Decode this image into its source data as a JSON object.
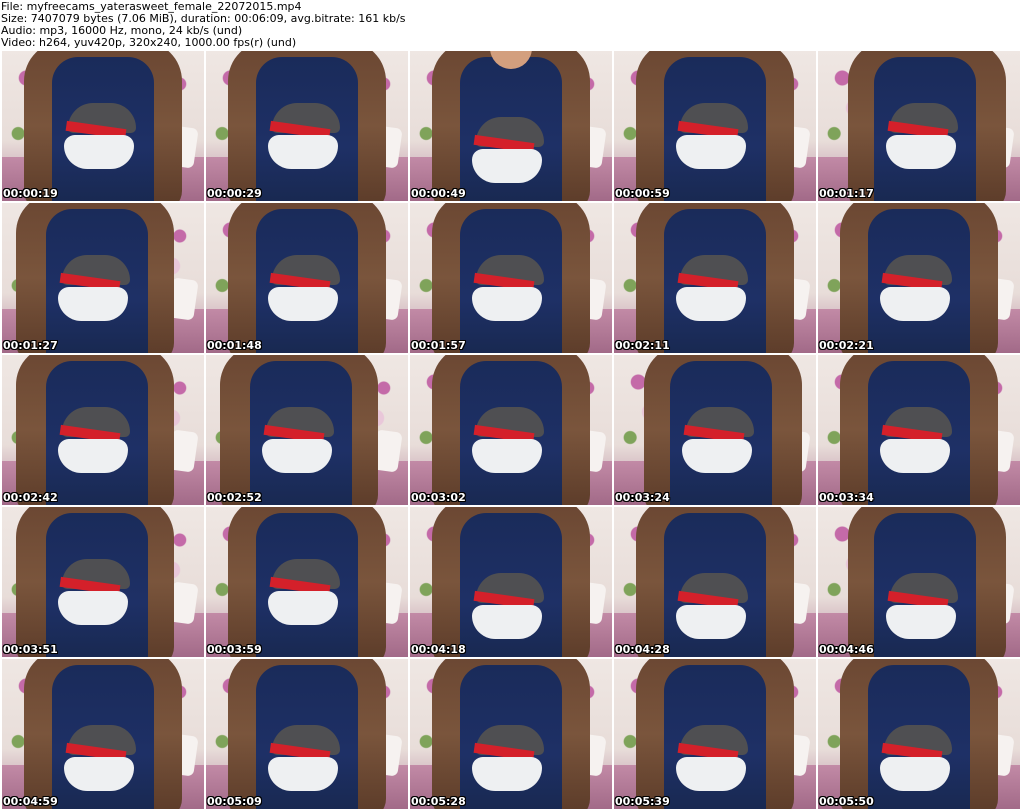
{
  "header": {
    "file_line": "File: myfreecams_yaterasweet_female_22072015.mp4",
    "size_line": "Size: 7407079 bytes (7.06 MiB), duration: 00:06:09, avg.bitrate: 161 kb/s",
    "audio_line": "Audio: mp3, 16000 Hz, mono, 24 kb/s (und)",
    "video_line": "Video: h264, yuv420p, 320x240, 1000.00 fps(r) (und)"
  },
  "thumbnails": [
    {
      "timestamp": "00:00:19"
    },
    {
      "timestamp": "00:00:29"
    },
    {
      "timestamp": "00:00:49"
    },
    {
      "timestamp": "00:00:59"
    },
    {
      "timestamp": "00:01:17"
    },
    {
      "timestamp": "00:01:27"
    },
    {
      "timestamp": "00:01:48"
    },
    {
      "timestamp": "00:01:57"
    },
    {
      "timestamp": "00:02:11"
    },
    {
      "timestamp": "00:02:21"
    },
    {
      "timestamp": "00:02:42"
    },
    {
      "timestamp": "00:02:52"
    },
    {
      "timestamp": "00:03:02"
    },
    {
      "timestamp": "00:03:24"
    },
    {
      "timestamp": "00:03:34"
    },
    {
      "timestamp": "00:03:51"
    },
    {
      "timestamp": "00:03:59"
    },
    {
      "timestamp": "00:04:18"
    },
    {
      "timestamp": "00:04:28"
    },
    {
      "timestamp": "00:04:46"
    },
    {
      "timestamp": "00:04:59"
    },
    {
      "timestamp": "00:05:09"
    },
    {
      "timestamp": "00:05:28"
    },
    {
      "timestamp": "00:05:39"
    },
    {
      "timestamp": "00:05:50"
    }
  ]
}
